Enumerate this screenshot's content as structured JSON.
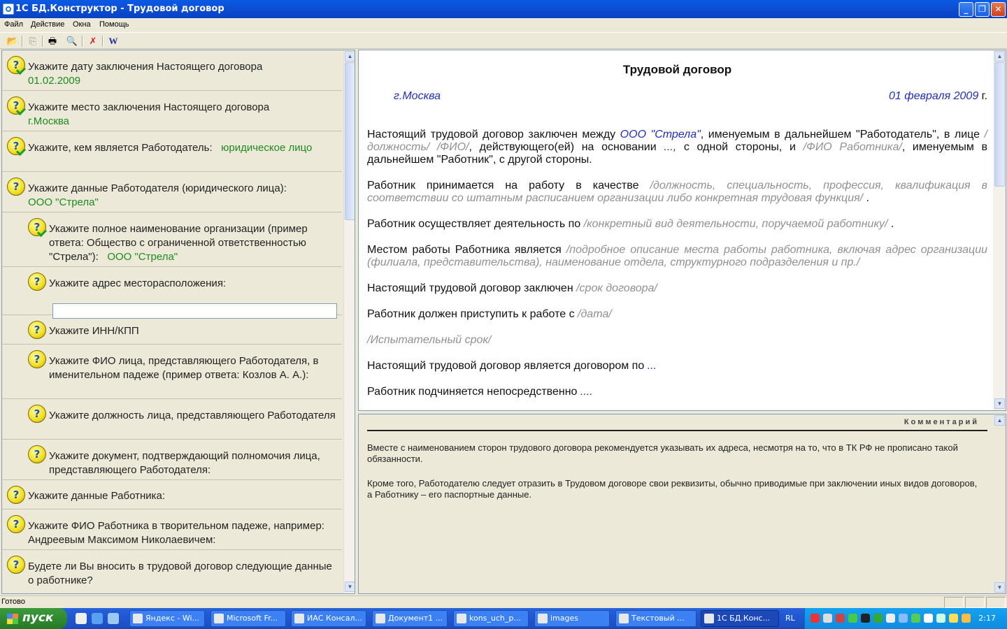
{
  "window": {
    "title": "1С БД.Конструктор - Трудовой договор"
  },
  "menu": [
    "Файл",
    "Действие",
    "Окна",
    "Помощь"
  ],
  "questions": [
    {
      "text": "Укажите дату заключения Настоящего договора",
      "answer": "01.02.2009",
      "done": true
    },
    {
      "text": "Укажите место заключения Настоящего договора",
      "answer": "г.Москва",
      "done": true
    },
    {
      "text": "Укажите, кем является Работодатель:",
      "answer": "юридическое лицо",
      "done": true
    },
    {
      "text": "Укажите данные Работодателя (юридического лица):",
      "answer": "ООО \"Стрела\"",
      "done": false
    },
    {
      "text": "Укажите полное наименование организации (пример ответа: Общество с ограниченной ответственностью \"Стрела\"):",
      "answer": "ООО \"Стрела\"",
      "done": true
    },
    {
      "text": "Укажите адрес месторасположения:",
      "answer": "",
      "done": false
    },
    {
      "text": "Укажите ИНН/КПП",
      "answer": "",
      "done": false
    },
    {
      "text": "Укажите ФИО лица, представляющего Работодателя, в именительном падеже (пример ответа: Козлов А. А.):",
      "answer": "",
      "done": false
    },
    {
      "text": "Укажите должность лица, представляющего Работодателя",
      "answer": "",
      "done": false
    },
    {
      "text": "Укажите документ, подтверждающий полномочия лица, представляющего Работодателя:",
      "answer": "",
      "done": false
    },
    {
      "text": "Укажите данные Работника:",
      "answer": "",
      "done": false
    },
    {
      "text": "Укажите ФИО Работника в творительном падеже, например: Андреевым Максимом Николаевичем:",
      "answer": "",
      "done": false
    },
    {
      "text": "Будете ли Вы вносить в трудовой договор следующие данные о работнике?",
      "answer": "",
      "done": false
    }
  ],
  "document": {
    "title": "Трудовой договор",
    "city": "г.Москва",
    "date": "01 февраля 2009",
    "date_suffix": " г.",
    "paragraphs": [
      [
        [
          "t",
          "Настоящий трудовой договор заключен между  "
        ],
        [
          "v",
          " ООО \"Стрела\""
        ],
        [
          "t",
          ", именуемым в дальнейшем \"Работодатель\", в лице "
        ],
        [
          "p",
          "/должность/  /ФИО/"
        ],
        [
          "t",
          ", действующего(ей) на основании "
        ],
        [
          "v",
          "...,"
        ],
        [
          "t",
          "        с одной стороны, и "
        ],
        [
          "p",
          "/ФИО Работника/"
        ],
        [
          "t",
          ", именуемым в дальнейшем \"Работник\", с другой стороны."
        ]
      ],
      [
        [
          "t",
          "Работник принимается на работу в качестве "
        ],
        [
          "p",
          "/должность, специальность, профессия, квалификация в соответствии со штатным расписанием организации либо конкретная трудовая функция/"
        ],
        [
          "t",
          " ."
        ]
      ],
      [
        [
          "t",
          "Работник осуществляет деятельность по "
        ],
        [
          "p",
          "/конкретный вид деятельности, поручаемой работнику/"
        ],
        [
          "t",
          " ."
        ]
      ],
      [
        [
          "t",
          "Местом работы Работника является "
        ],
        [
          "p",
          "/подробное описание места работы работника, включая адрес организации (филиала, представительства), наименование отдела, структурного подразделения и пр./"
        ]
      ],
      [
        [
          "t",
          "Настоящий трудовой договор заключен "
        ],
        [
          "p",
          "/срок договора/"
        ]
      ],
      [
        [
          "t",
          "Работник должен приступить к работе с "
        ],
        [
          "p",
          "/дата/"
        ]
      ],
      [
        [
          "p",
          "/Испытательный срок/"
        ]
      ],
      [
        [
          "t",
          "Настоящий трудовой договор является договором по "
        ],
        [
          "v",
          "..."
        ]
      ],
      [
        [
          "t",
          "Работник подчиняется непосредственно "
        ],
        [
          "v",
          "...."
        ]
      ]
    ]
  },
  "comment": {
    "header": "Комментарий",
    "paragraphs": [
      "Вместе с наименованием сторон трудового договора рекомендуется указывать их адреса, несмотря на то, что в ТК РФ не прописано такой обязанности.",
      "Кроме того, Работодателю следует отразить в Трудовом договоре свои реквизиты, обычно приводимые при заключении иных видов договоров, а Работнику – его паспортные данные."
    ]
  },
  "status": {
    "text": "Готово"
  },
  "taskbar": {
    "start": "пуск",
    "tasks": [
      "Яндекс - Wi...",
      "Microsoft Fr...",
      "ИАС Консал...",
      "Документ1 ...",
      "kons_uch_p...",
      "images",
      "Текстовый ...",
      "1С БД.Конс..."
    ],
    "lang": "RL",
    "clock": "2:17"
  },
  "colors": {
    "answer": "#1f8a1f",
    "field_value": "#1f2fb3",
    "placeholder": "#909090"
  }
}
